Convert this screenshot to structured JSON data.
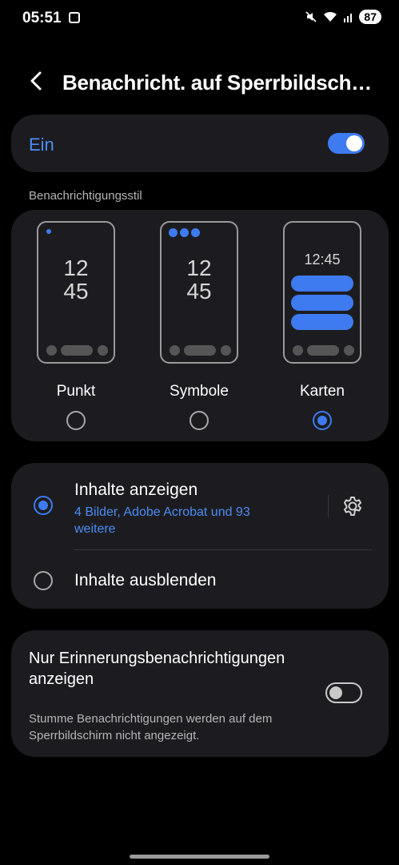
{
  "status_bar": {
    "time": "05:51",
    "battery": "87",
    "icons": [
      "gallery-icon",
      "mute-icon",
      "wifi-icon",
      "signal-icon"
    ]
  },
  "header": {
    "title": "Benachricht. auf Sperrbildsch…"
  },
  "master": {
    "label": "Ein",
    "enabled": true
  },
  "style_section": {
    "label": "Benachrichtigungsstil",
    "clock_hours": "12",
    "clock_minutes": "45",
    "clock_time": "12:45",
    "options": [
      {
        "label": "Punkt",
        "selected": false
      },
      {
        "label": "Symbole",
        "selected": false
      },
      {
        "label": "Karten",
        "selected": true
      }
    ]
  },
  "content": {
    "show_title": "Inhalte anzeigen",
    "show_subtitle": "4 Bilder, Adobe Acrobat und 93 weitere",
    "show_selected": true,
    "hide_title": "Inhalte ausblenden",
    "hide_selected": false
  },
  "reminder": {
    "title": "Nur Erinnerungsbenachrichtigungen anzeigen",
    "description": "Stumme Benachrichtigungen werden auf dem Sperrbildschirm nicht angezeigt.",
    "enabled": false
  },
  "colors": {
    "accent": "#3e7bf0",
    "card": "#1c1c20",
    "background": "#000000"
  }
}
